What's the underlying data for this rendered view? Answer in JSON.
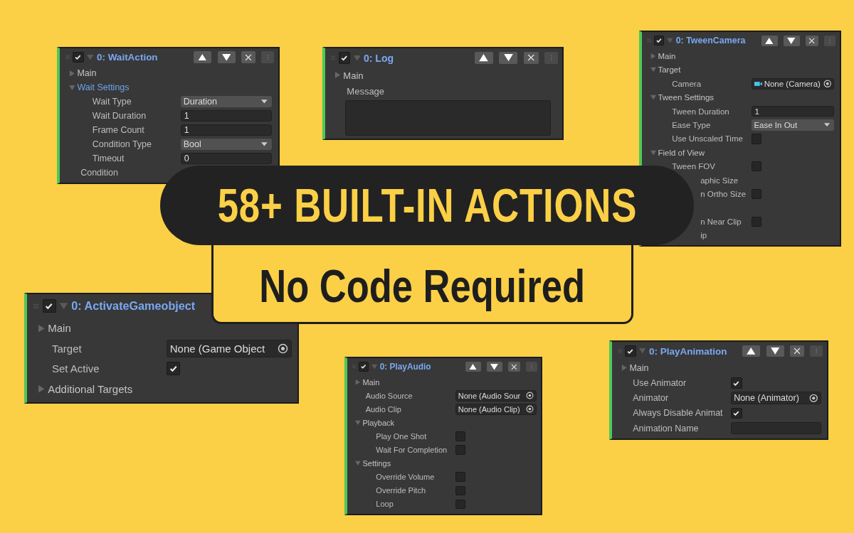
{
  "headline": "58+ BUILT-IN ACTIONS",
  "subheadline": "No Code Required",
  "panels": [
    {
      "title": "0: WaitAction",
      "enabled": true,
      "rows": [
        {
          "kind": "section",
          "label": "Main",
          "expanded": false,
          "selected": false
        },
        {
          "kind": "section",
          "label": "Wait Settings",
          "expanded": true,
          "selected": true,
          "children": [
            {
              "kind": "dropdown",
              "label": "Wait Type",
              "value": "Duration"
            },
            {
              "kind": "text",
              "label": "Wait Duration",
              "value": "1"
            },
            {
              "kind": "text",
              "label": "Frame Count",
              "value": "1"
            },
            {
              "kind": "dropdown",
              "label": "Condition Type",
              "value": "Bool"
            },
            {
              "kind": "text",
              "label": "Timeout",
              "value": "0"
            }
          ]
        },
        {
          "kind": "label",
          "label": "Condition"
        }
      ]
    },
    {
      "title": "0: Log",
      "enabled": true,
      "rows": [
        {
          "kind": "section",
          "label": "Main",
          "expanded": false,
          "selected": false
        },
        {
          "kind": "label",
          "label": "Message"
        },
        {
          "kind": "textarea"
        }
      ]
    },
    {
      "title": "0: TweenCamera",
      "enabled": true,
      "rows": [
        {
          "kind": "section",
          "label": "Main",
          "expanded": false,
          "selected": false
        },
        {
          "kind": "section",
          "label": "Target",
          "expanded": true,
          "selected": false,
          "children": [
            {
              "kind": "object",
              "label": "Camera",
              "value": "None (Camera)",
              "has_icon": true
            }
          ]
        },
        {
          "kind": "section",
          "label": "Tween Settings",
          "expanded": true,
          "selected": false,
          "children": [
            {
              "kind": "text",
              "label": "Tween Duration",
              "value": "1"
            },
            {
              "kind": "dropdown",
              "label": "Ease Type",
              "value": "Ease In Out"
            },
            {
              "kind": "toggle",
              "label": "Use Unscaled Time",
              "checked": false
            }
          ]
        },
        {
          "kind": "section",
          "label": "Field of View",
          "expanded": true,
          "selected": false,
          "children": [
            {
              "kind": "toggle",
              "label": "Tween FOV",
              "checked": false
            },
            {
              "kind": "label",
              "label": "aphic Size",
              "cut": true
            },
            {
              "kind": "toggle",
              "label": "n Ortho Size",
              "checked": false,
              "cut": true
            },
            {
              "kind": "gap"
            },
            {
              "kind": "toggle",
              "label": "n Near Clip",
              "checked": false,
              "cut": true
            },
            {
              "kind": "label",
              "label": "ip",
              "cut": true
            }
          ]
        }
      ]
    },
    {
      "title": "0: ActivateGameobject",
      "enabled": true,
      "rows": [
        {
          "kind": "section",
          "label": "Main",
          "expanded": false,
          "selected": false
        },
        {
          "kind": "object",
          "label": "Target",
          "value": "None (Game Object",
          "has_icon": false
        },
        {
          "kind": "toggle",
          "label": "Set Active",
          "checked": true
        },
        {
          "kind": "section",
          "label": "Additional Targets",
          "expanded": false,
          "selected": false
        }
      ]
    },
    {
      "title": "0: PlayAudio",
      "enabled": true,
      "rows": [
        {
          "kind": "section",
          "label": "Main",
          "expanded": false,
          "selected": false
        },
        {
          "kind": "object",
          "label": "Audio Source",
          "value": "None (Audio Sour",
          "has_icon": false
        },
        {
          "kind": "object",
          "label": "Audio Clip",
          "value": "None (Audio Clip)",
          "has_icon": false
        },
        {
          "kind": "section",
          "label": "Playback",
          "expanded": true,
          "selected": false,
          "children": [
            {
              "kind": "toggle",
              "label": "Play One Shot",
              "checked": false
            },
            {
              "kind": "toggle",
              "label": "Wait For Completion",
              "checked": false
            }
          ]
        },
        {
          "kind": "section",
          "label": "Settings",
          "expanded": true,
          "selected": false,
          "children": [
            {
              "kind": "toggle",
              "label": "Override Volume",
              "checked": false
            },
            {
              "kind": "toggle",
              "label": "Override Pitch",
              "checked": false
            },
            {
              "kind": "toggle",
              "label": "Loop",
              "checked": false
            }
          ]
        }
      ]
    },
    {
      "title": "0: PlayAnimation",
      "enabled": true,
      "rows": [
        {
          "kind": "section",
          "label": "Main",
          "expanded": false,
          "selected": false
        },
        {
          "kind": "toggle",
          "label": "Use Animator",
          "checked": true
        },
        {
          "kind": "object",
          "label": "Animator",
          "value": "None (Animator)",
          "has_icon": false
        },
        {
          "kind": "toggle",
          "label": "Always Disable Animat",
          "checked": true
        },
        {
          "kind": "text",
          "label": "Animation Name"
        }
      ]
    }
  ]
}
